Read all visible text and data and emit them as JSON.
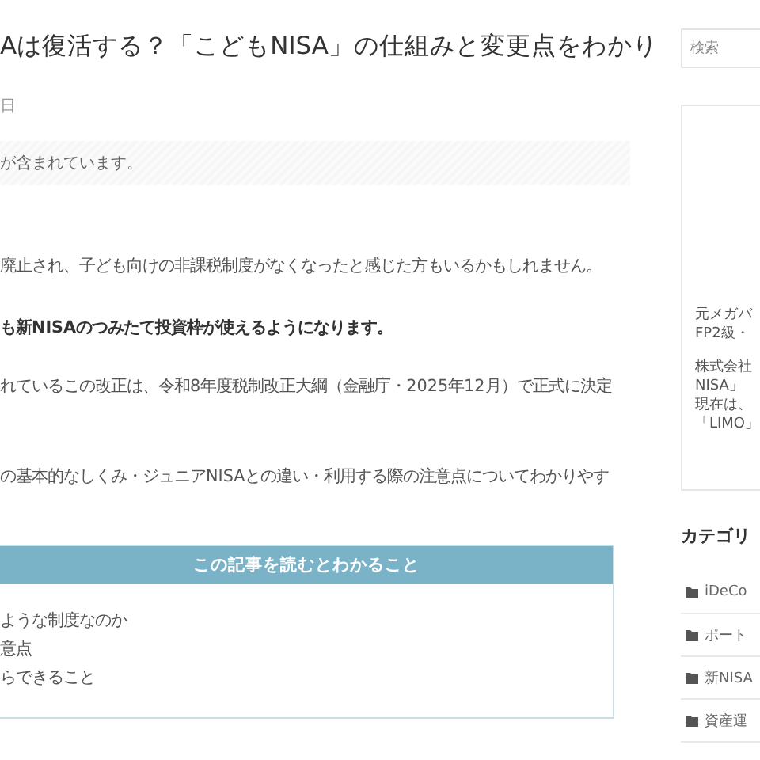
{
  "article": {
    "title": "Aは復活する？「こどもNISA」の仕組みと変更点をわかり",
    "date": "日",
    "notice": "が含まれています。",
    "paragraphs": [
      {
        "text": "廃止され、子ども向けの非課税制度がなくなったと感じた方もいるかもしれません。",
        "bold": false
      },
      {
        "text": "も新NISAのつみたて投資枠が使えるようになります。",
        "bold": true
      },
      {
        "text": "れているこの改正は、令和8年度税制改正大綱（金融庁・2025年12月）で正式に決定",
        "bold": false
      },
      {
        "text": "の基本的なしくみ・ジュニアNISAとの違い・利用する際の注意点についてわかりやす",
        "bold": false
      }
    ]
  },
  "summary": {
    "heading": "この記事を読むとわかること",
    "items": [
      "ような制度なのか",
      "意点",
      "らできること"
    ]
  },
  "sidebar": {
    "search": {
      "placeholder": "検索"
    },
    "profile": [
      [
        "元メガバ",
        "FP2級・"
      ],
      [
        "株式会社",
        "NISA」",
        "現在は、",
        "「LIMO」"
      ]
    ],
    "categories": {
      "heading": "カテゴリ",
      "items": [
        "iDeCo",
        "ポート",
        "新NISA",
        "資産運"
      ]
    }
  }
}
